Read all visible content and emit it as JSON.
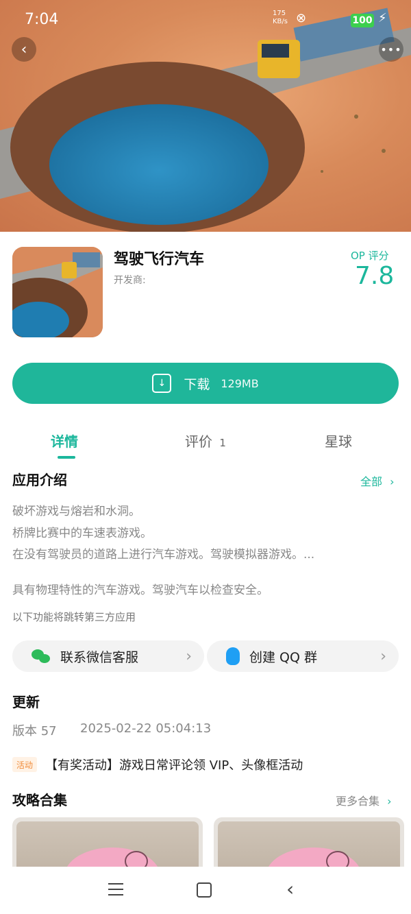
{
  "status": {
    "time": "7:04",
    "network_speed": "175\nKB/s",
    "battery": "100"
  },
  "app": {
    "title": "驾驶飞行汽车",
    "developer_label": "开发商:",
    "op_label": "OP 评分",
    "op_score": "7.8"
  },
  "download": {
    "label": "下载",
    "size": "129MB"
  },
  "tabs": [
    {
      "label": "详情",
      "active": true
    },
    {
      "label": "评价",
      "count": "1"
    },
    {
      "label": "星球"
    }
  ],
  "intro": {
    "title": "应用介绍",
    "all_label": "全部",
    "line1": "破坏游戏与熔岩和水洞。",
    "line2": "桥牌比赛中的车速表游戏。",
    "line3": "在没有驾驶员的道路上进行汽车游戏。驾驶模拟器游戏。...",
    "line4": "具有物理特性的汽车游戏。驾驶汽车以检查安全。",
    "note": "以下功能将跳转第三方应用"
  },
  "contact": {
    "wechat_label": "联系微信客服",
    "qq_label": "创建 QQ 群"
  },
  "update": {
    "title": "更新",
    "version": "版本 57",
    "datetime": "2025-02-22 05:04:13"
  },
  "activity": {
    "badge": "活动",
    "text": "【有奖活动】游戏日常评论领 VIP、头像框活动"
  },
  "guides": {
    "title": "攻略合集",
    "more_label": "更多合集"
  },
  "colors": {
    "accent": "#1fb69a",
    "badge_bg": "#fff2e5",
    "badge_fg": "#f08c3b"
  }
}
